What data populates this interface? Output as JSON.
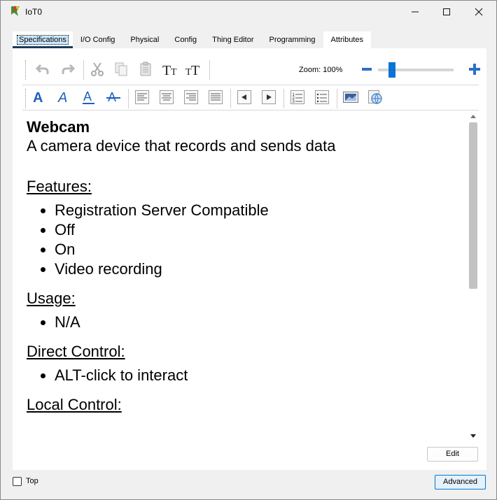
{
  "window": {
    "title": "IoT0"
  },
  "tabs": [
    {
      "label": "Specifications"
    },
    {
      "label": "I/O Config"
    },
    {
      "label": "Physical"
    },
    {
      "label": "Config"
    },
    {
      "label": "Thing Editor"
    },
    {
      "label": "Programming"
    },
    {
      "label": "Attributes"
    }
  ],
  "toolbar": {
    "zoom_label": "Zoom: 100%",
    "zoom_level_percent": 100
  },
  "document": {
    "title": "Webcam",
    "subtitle": "A camera device that records and sends data",
    "sections": [
      {
        "heading": "Features:",
        "items": [
          "Registration Server Compatible",
          "Off",
          "On",
          "Video recording"
        ]
      },
      {
        "heading": "Usage:",
        "items": [
          "N/A"
        ]
      },
      {
        "heading": "Direct Control:",
        "items": [
          "ALT-click to interact"
        ]
      },
      {
        "heading": "Local Control:",
        "items": []
      }
    ]
  },
  "buttons": {
    "edit": "Edit",
    "advanced": "Advanced"
  },
  "footer": {
    "top_label": "Top",
    "top_checked": false
  },
  "colors": {
    "accent": "#0078d4",
    "tab_underline": "#1b3a5c",
    "format_blue": "#1f5fbf"
  }
}
